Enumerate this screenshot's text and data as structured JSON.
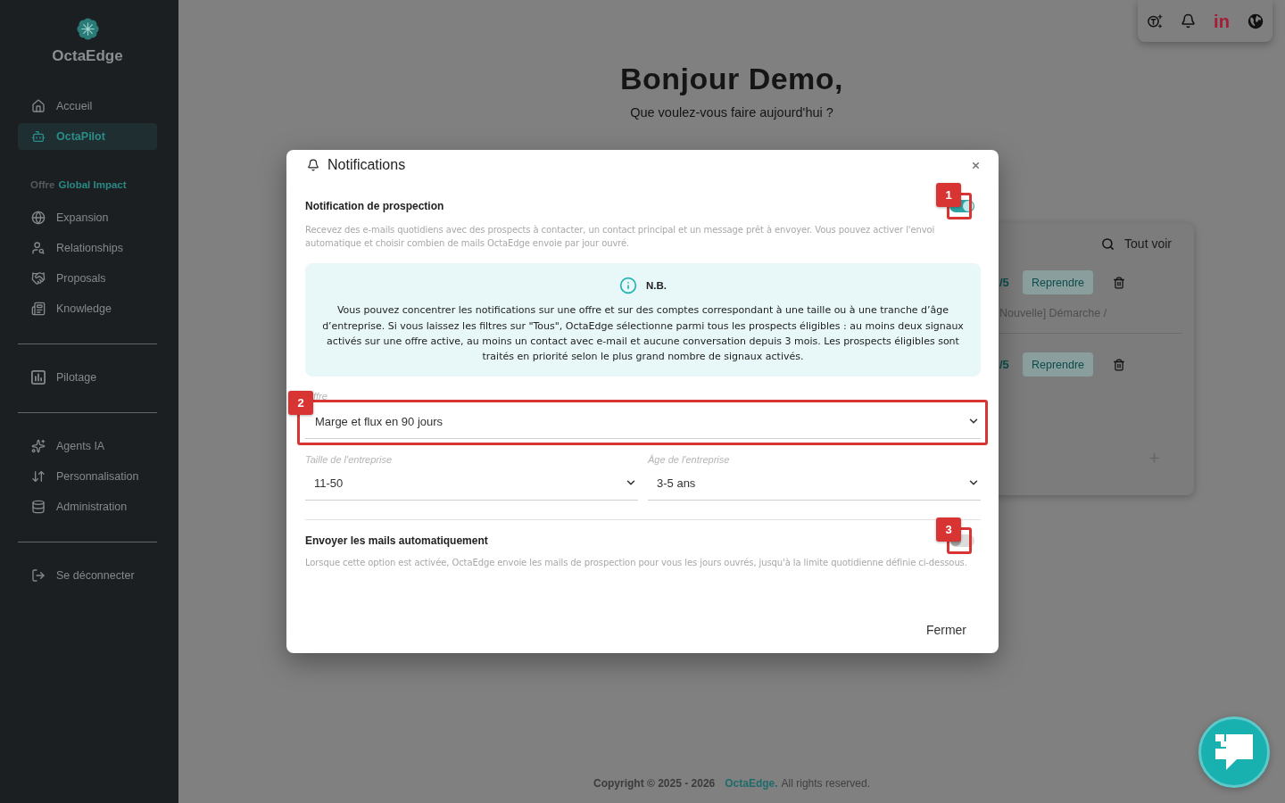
{
  "sidebar": {
    "brand": "OctaEdge",
    "groups": [
      {
        "separated": false,
        "items": [
          {
            "label": "Accueil",
            "selected": false
          },
          {
            "label": "OctaPilot",
            "selected": true
          }
        ]
      },
      {
        "separated": false,
        "heading": {
          "prefix": "Offre",
          "name": "Global Impact"
        },
        "items": [
          {
            "label": "Expansion",
            "selected": false
          },
          {
            "label": "Relationships",
            "selected": false
          },
          {
            "label": "Proposals",
            "selected": false
          },
          {
            "label": "Knowledge",
            "selected": false
          }
        ]
      },
      {
        "separated": true,
        "items": [
          {
            "label": "Pilotage",
            "selected": false
          }
        ]
      },
      {
        "separated": true,
        "items": [
          {
            "label": "Agents IA",
            "selected": false
          },
          {
            "label": "Personnalisation",
            "selected": false
          },
          {
            "label": "Administration",
            "selected": false
          }
        ]
      },
      {
        "separated": true,
        "items": [
          {
            "label": "Se déconnecter",
            "selected": false
          }
        ]
      }
    ]
  },
  "top_bar": {
    "linkedin_text": "in"
  },
  "greeting": {
    "title": "Bonjour Demo,",
    "subtitle": "Que voulez-vous faire aujourd'hui ?"
  },
  "drafts_card": {
    "view_all": "Tout voir",
    "rows": [
      {
        "progress": "/5",
        "action": "Reprendre",
        "subtitle": "Nouvelle] Démarche /"
      },
      {
        "progress": "/5",
        "action": "Reprendre"
      }
    ]
  },
  "notification_dialog": {
    "title": "Notifications",
    "prospection": {
      "title": "Notification de prospection",
      "on": true,
      "callout": "1",
      "description": "Recevez des e-mails quotidiens avec des prospects à contacter, un contact principal et un message prêt à envoyer. Vous pouvez activer l'envoi automatique et choisir combien de mails OctaEdge envoie par jour ouvré."
    },
    "note": {
      "title": "N.B.",
      "text": "Vous pouvez concentrer les notifications sur une offre et sur des comptes correspondant à une taille ou à une tranche d’âge d’entreprise. Si vous laissez les filtres sur \"Tous\", OctaEdge sélectionne parmi tous les prospects éligibles : au moins deux signaux activés sur une offre active, au moins un contact avec e-mail et aucune conversation depuis 3 mois. Les prospects éligibles sont traités en priorité selon le plus grand nombre de signaux activés."
    },
    "offer": {
      "label": "ffre",
      "value": "Marge et flux en 90 jours",
      "callout": "2"
    },
    "company_size": {
      "label": "Taille de l'entreprise",
      "value": "11-50"
    },
    "company_age": {
      "label": "Âge de l'entreprise",
      "value": "3-5 ans"
    },
    "auto_send": {
      "title": "Envoyer les mails automatiquement",
      "on": false,
      "callout": "3",
      "description": "Lorsque cette option est activée, OctaEdge envoie les mails de prospection pour vous les jours ouvrés, jusqu'à la limite quotidienne définie ci-dessous."
    },
    "close_button": "Fermer"
  },
  "footer": {
    "copyright": "Copyright © 2025 - 2026",
    "brand": "OctaEdge.",
    "rights": "All rights reserved."
  }
}
